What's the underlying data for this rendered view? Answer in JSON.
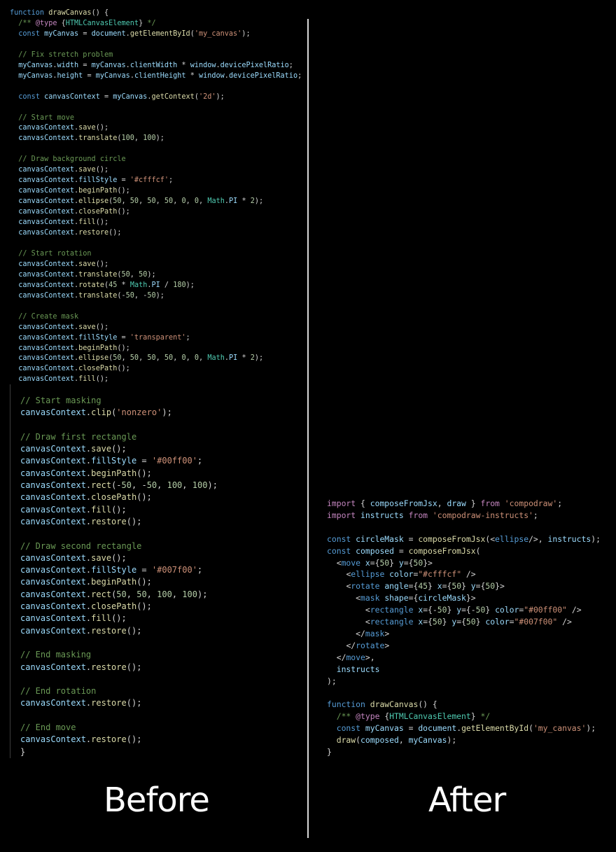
{
  "colors": {
    "background": "#000000",
    "keyword": "#569cd6",
    "control": "#c586c0",
    "variable": "#9cdcfe",
    "function": "#dcdcaa",
    "string": "#ce9178",
    "number": "#b5cea8",
    "comment": "#6a9955",
    "tag": "#569cd6",
    "type": "#4ec9b0",
    "punctuation": "#d4d4d4"
  },
  "captions": {
    "before": "Before",
    "after": "After"
  },
  "before_code_top": [
    "function drawCanvas() {",
    "  /** @type {HTMLCanvasElement} */",
    "  const myCanvas = document.getElementById('my_canvas');",
    "",
    "  // Fix stretch problem",
    "  myCanvas.width = myCanvas.clientWidth * window.devicePixelRatio;",
    "  myCanvas.height = myCanvas.clientHeight * window.devicePixelRatio;",
    "",
    "  const canvasContext = myCanvas.getContext('2d');",
    "",
    "  // Start move",
    "  canvasContext.save();",
    "  canvasContext.translate(100, 100);",
    "",
    "  // Draw background circle",
    "  canvasContext.save();",
    "  canvasContext.fillStyle = '#cfffcf';",
    "  canvasContext.beginPath();",
    "  canvasContext.ellipse(50, 50, 50, 50, 0, 0, Math.PI * 2);",
    "  canvasContext.closePath();",
    "  canvasContext.fill();",
    "  canvasContext.restore();",
    "",
    "  // Start rotation",
    "  canvasContext.save();",
    "  canvasContext.translate(50, 50);",
    "  canvasContext.rotate(45 * Math.PI / 180);",
    "  canvasContext.translate(-50, -50);",
    "",
    "  // Create mask",
    "  canvasContext.save();",
    "  canvasContext.fillStyle = 'transparent';",
    "  canvasContext.beginPath();",
    "  canvasContext.ellipse(50, 50, 50, 50, 0, 0, Math.PI * 2);",
    "  canvasContext.closePath();",
    "  canvasContext.fill();"
  ],
  "before_code_bottom": [
    "// Start masking",
    "canvasContext.clip('nonzero');",
    "",
    "// Draw first rectangle",
    "canvasContext.save();",
    "canvasContext.fillStyle = '#00ff00';",
    "canvasContext.beginPath();",
    "canvasContext.rect(-50, -50, 100, 100);",
    "canvasContext.closePath();",
    "canvasContext.fill();",
    "canvasContext.restore();",
    "",
    "// Draw second rectangle",
    "canvasContext.save();",
    "canvasContext.fillStyle = '#007f00';",
    "canvasContext.beginPath();",
    "canvasContext.rect(50, 50, 100, 100);",
    "canvasContext.closePath();",
    "canvasContext.fill();",
    "canvasContext.restore();",
    "",
    "// End masking",
    "canvasContext.restore();",
    "",
    "// End rotation",
    "canvasContext.restore();",
    "",
    "// End move",
    "canvasContext.restore();",
    "}"
  ],
  "after_code": [
    "import { composeFromJsx, draw } from 'compodraw';",
    "import instructs from 'compodraw-instructs';",
    "",
    "const circleMask = composeFromJsx(<ellipse/>, instructs);",
    "const composed = composeFromJsx(",
    "  <move x={50} y={50}>",
    "    <ellipse color=\"#cfffcf\" />",
    "    <rotate angle={45} x={50} y={50}>",
    "      <mask shape={circleMask}>",
    "        <rectangle x={-50} y={-50} color=\"#00ff00\" />",
    "        <rectangle x={50} y={50} color=\"#007f00\" />",
    "      </mask>",
    "    </rotate>",
    "  </move>,",
    "  instructs",
    ");",
    "",
    "function drawCanvas() {",
    "  /** @type {HTMLCanvasElement} */",
    "  const myCanvas = document.getElementById('my_canvas');",
    "  draw(composed, myCanvas);",
    "}"
  ]
}
